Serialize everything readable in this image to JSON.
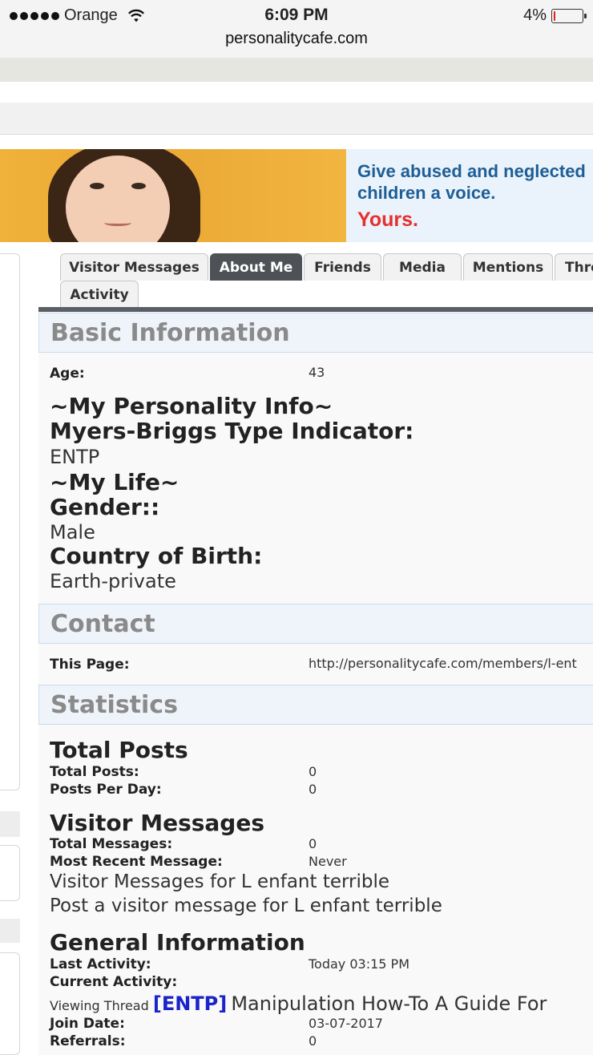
{
  "status_bar": {
    "carrier": "Orange",
    "time": "6:09 PM",
    "url": "personalitycafe.com",
    "battery_percent": "4%",
    "battery_level": 0.04
  },
  "ad": {
    "line1": "Give abused and neglected",
    "line2": "children a voice.",
    "line3": "Yours.",
    "colors": {
      "blue": "#1e5e96",
      "red": "#e5302f"
    }
  },
  "tabs": [
    {
      "label": "Visitor Messages",
      "active": false
    },
    {
      "label": "About Me",
      "active": true
    },
    {
      "label": "Friends",
      "active": false
    },
    {
      "label": "Media",
      "active": false
    },
    {
      "label": "Mentions",
      "active": false
    },
    {
      "label": "Thre",
      "active": false
    },
    {
      "label": "Activity",
      "active": false
    }
  ],
  "basic": {
    "heading": "Basic Information",
    "age_label": "Age:",
    "age_value": "43",
    "personality_heading": "~My Personality Info~",
    "mbti_label": "Myers-Briggs Type Indicator:",
    "mbti_value": "ENTP",
    "life_heading": "~My Life~",
    "gender_label": "Gender::",
    "gender_value": "Male",
    "country_label": "Country of Birth:",
    "country_value": "Earth-private"
  },
  "contact": {
    "heading": "Contact",
    "page_label": "This Page:",
    "page_value": "http://personalitycafe.com/members/l-ent"
  },
  "statistics": {
    "heading": "Statistics",
    "total_posts_heading": "Total Posts",
    "total_posts_label": "Total Posts:",
    "total_posts_value": "0",
    "posts_per_day_label": "Posts Per Day:",
    "posts_per_day_value": "0",
    "vm_heading": "Visitor Messages",
    "total_messages_label": "Total Messages:",
    "total_messages_value": "0",
    "recent_label": "Most Recent Message:",
    "recent_value": "Never",
    "vm_link": "Visitor Messages for L enfant terrible",
    "post_link": "Post a visitor message for L enfant terrible",
    "general_heading": "General Information",
    "last_activity_label": "Last Activity:",
    "last_activity_value": "Today 03:15 PM",
    "current_activity_label": "Current Activity:",
    "viewing_prefix": "Viewing Thread",
    "viewing_tag": "[ENTP]",
    "viewing_title": "Manipulation How-To A Guide For",
    "join_label": "Join Date:",
    "join_value": "03-07-2017",
    "referrals_label": "Referrals:",
    "referrals_value": "0"
  }
}
